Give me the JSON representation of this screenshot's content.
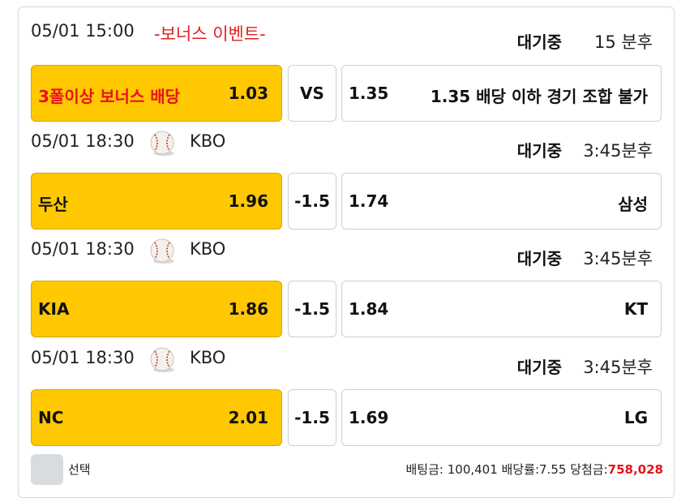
{
  "games": [
    {
      "datetime": "05/01 15:00",
      "event_label": "-보너스 이벤트-",
      "league": "",
      "status": "대기중",
      "remaining": "15 분후",
      "home": {
        "name": "3폴이상 보너스 배당",
        "odds": "1.03",
        "highlight": true
      },
      "handicap": "VS",
      "away": {
        "odds": "1.35",
        "name": "1.35 배당 이하 경기 조합 불가"
      }
    },
    {
      "datetime": "05/01 18:30",
      "event_label": "",
      "league": "KBO",
      "icon": "baseball-icon",
      "status": "대기중",
      "remaining": "3:45분후",
      "home": {
        "name": "두산",
        "odds": "1.96",
        "highlight": false
      },
      "handicap": "-1.5",
      "away": {
        "odds": "1.74",
        "name": "삼성"
      }
    },
    {
      "datetime": "05/01 18:30",
      "event_label": "",
      "league": "KBO",
      "icon": "baseball-icon",
      "status": "대기중",
      "remaining": "3:45분후",
      "home": {
        "name": "KIA",
        "odds": "1.86",
        "highlight": false
      },
      "handicap": "-1.5",
      "away": {
        "odds": "1.84",
        "name": "KT"
      }
    },
    {
      "datetime": "05/01 18:30",
      "event_label": "",
      "league": "KBO",
      "icon": "baseball-icon",
      "status": "대기중",
      "remaining": "3:45분후",
      "home": {
        "name": "NC",
        "odds": "2.01",
        "highlight": false
      },
      "handicap": "-1.5",
      "away": {
        "odds": "1.69",
        "name": "LG"
      }
    }
  ],
  "footer": {
    "select_label": "선택",
    "bet_amount_label": "배팅금:",
    "bet_amount": "100,401",
    "odds_total_label": "배당률:",
    "odds_total": "7.55",
    "payout_label": "당첨금:",
    "payout": "758,028"
  },
  "colors": {
    "selected_box": "#ffc800",
    "accent_red": "#e8121b",
    "border": "#cfcfcf"
  }
}
